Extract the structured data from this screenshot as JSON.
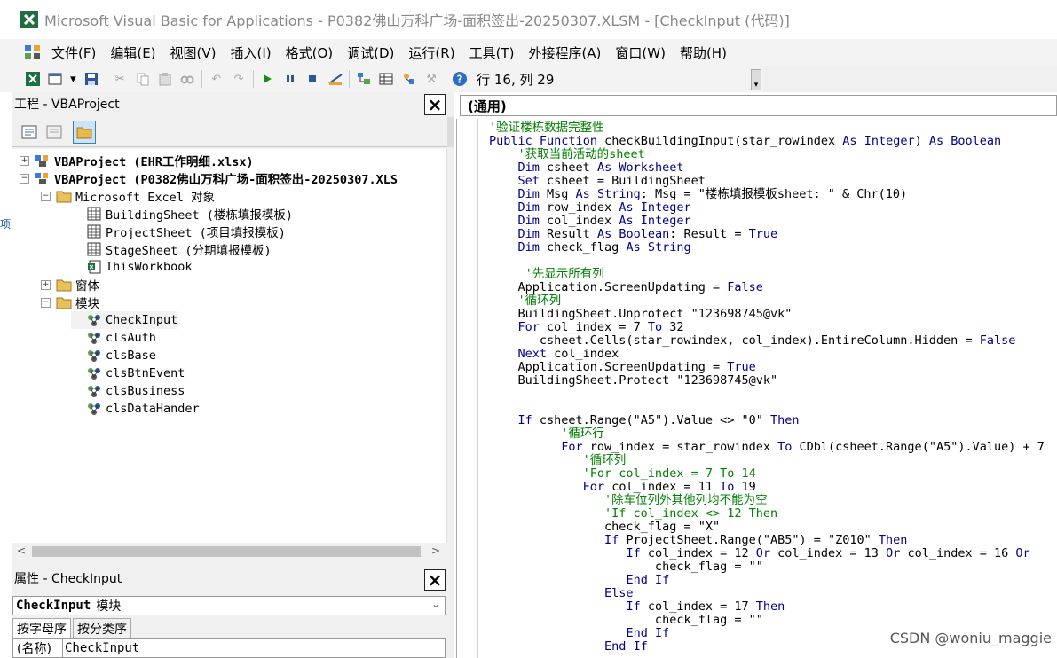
{
  "window": {
    "title": "Microsoft Visual Basic for Applications - P0382佛山万科广场-面积签出-20250307.XLSM - [CheckInput (代码)]"
  },
  "menu": [
    "文件(F)",
    "编辑(E)",
    "视图(V)",
    "插入(I)",
    "格式(O)",
    "调试(D)",
    "运行(R)",
    "工具(T)",
    "外接程序(A)",
    "窗口(W)",
    "帮助(H)"
  ],
  "toolbar": {
    "cursor_position": "行 16, 列 29"
  },
  "project_pane": {
    "title": "工程 - VBAProject",
    "tree": [
      {
        "label": "VBAProject (EHR工作明细.xlsx)",
        "level": 0,
        "expander": "+",
        "icon": "vba-project-icon",
        "bold": true
      },
      {
        "label": "VBAProject (P0382佛山万科广场-面积签出-20250307.XLS",
        "level": 0,
        "expander": "-",
        "icon": "vba-project-icon",
        "bold": true
      },
      {
        "label": "Microsoft Excel 对象",
        "level": 1,
        "expander": "-",
        "icon": "folder-icon",
        "bold": false
      },
      {
        "label": "BuildingSheet (楼栋填报模板)",
        "level": 2,
        "expander": "",
        "icon": "sheet-icon",
        "bold": false
      },
      {
        "label": "ProjectSheet (项目填报模板)",
        "level": 2,
        "expander": "",
        "icon": "sheet-icon",
        "bold": false
      },
      {
        "label": "StageSheet (分期填报模板)",
        "level": 2,
        "expander": "",
        "icon": "sheet-icon",
        "bold": false
      },
      {
        "label": "ThisWorkbook",
        "level": 2,
        "expander": "",
        "icon": "workbook-icon",
        "bold": false
      },
      {
        "label": "窗体",
        "level": 1,
        "expander": "+",
        "icon": "folder-icon",
        "bold": false
      },
      {
        "label": "模块",
        "level": 1,
        "expander": "-",
        "icon": "folder-icon",
        "bold": false
      },
      {
        "label": "CheckInput",
        "level": 2,
        "expander": "",
        "icon": "module-icon",
        "bold": false,
        "selected": true
      },
      {
        "label": "clsAuth",
        "level": 2,
        "expander": "",
        "icon": "module-icon",
        "bold": false
      },
      {
        "label": "clsBase",
        "level": 2,
        "expander": "",
        "icon": "module-icon",
        "bold": false
      },
      {
        "label": "clsBtnEvent",
        "level": 2,
        "expander": "",
        "icon": "module-icon",
        "bold": false
      },
      {
        "label": "clsBusiness",
        "level": 2,
        "expander": "",
        "icon": "module-icon",
        "bold": false
      },
      {
        "label": "clsDataHander",
        "level": 2,
        "expander": "",
        "icon": "module-icon",
        "bold": false
      }
    ]
  },
  "properties_pane": {
    "title": "属性 - CheckInput",
    "object_name": "CheckInput",
    "object_type": "模块",
    "tabs": [
      "按字母序",
      "按分类序"
    ],
    "rows": [
      {
        "key": "(名称)",
        "value": "CheckInput"
      }
    ]
  },
  "code_window": {
    "scope_combo": "(通用)",
    "lines": [
      {
        "text": "'验证楼栋数据完整性",
        "type": "comment"
      },
      {
        "text": "Public Function checkBuildingInput(star_rowindex As Integer) As Boolean",
        "type": "code"
      },
      {
        "text": "    '获取当前活动的sheet",
        "type": "comment"
      },
      {
        "text": "    Dim csheet As Worksheet",
        "type": "code"
      },
      {
        "text": "    Set csheet = BuildingSheet",
        "type": "code"
      },
      {
        "text": "    Dim Msg As String: Msg = \"楼栋填报模板sheet: \" & Chr(10)",
        "type": "code"
      },
      {
        "text": "    Dim row_index As Integer",
        "type": "code"
      },
      {
        "text": "    Dim col_index As Integer",
        "type": "code"
      },
      {
        "text": "    Dim Result As Boolean: Result = True",
        "type": "code"
      },
      {
        "text": "    Dim check_flag As String",
        "type": "code"
      },
      {
        "text": "",
        "type": "code"
      },
      {
        "text": "     '先显示所有列",
        "type": "comment"
      },
      {
        "text": "    Application.ScreenUpdating = False",
        "type": "code"
      },
      {
        "text": "    '循环列",
        "type": "comment"
      },
      {
        "text": "    BuildingSheet.Unprotect \"123698745@vk\"",
        "type": "code"
      },
      {
        "text": "    For col_index = 7 To 32",
        "type": "code"
      },
      {
        "text": "       csheet.Cells(star_rowindex, col_index).EntireColumn.Hidden = False",
        "type": "code"
      },
      {
        "text": "    Next col_index",
        "type": "code"
      },
      {
        "text": "    Application.ScreenUpdating = True",
        "type": "code"
      },
      {
        "text": "    BuildingSheet.Protect \"123698745@vk\"",
        "type": "code"
      },
      {
        "text": "",
        "type": "code"
      },
      {
        "text": "",
        "type": "code"
      },
      {
        "text": "    If csheet.Range(\"A5\").Value <> \"0\" Then",
        "type": "code"
      },
      {
        "text": "          '循环行",
        "type": "comment"
      },
      {
        "text": "          For row_index = star_rowindex To CDbl(csheet.Range(\"A5\").Value) + 7",
        "type": "code"
      },
      {
        "text": "             '循环列",
        "type": "comment"
      },
      {
        "text": "             'For col_index = 7 To 14",
        "type": "comment"
      },
      {
        "text": "             For col_index = 11 To 19",
        "type": "code"
      },
      {
        "text": "                '除车位列外其他列均不能为空",
        "type": "comment"
      },
      {
        "text": "                'If col_index <> 12 Then",
        "type": "comment"
      },
      {
        "text": "                check_flag = \"X\"",
        "type": "code"
      },
      {
        "text": "                If ProjectSheet.Range(\"AB5\") = \"Z010\" Then",
        "type": "code"
      },
      {
        "text": "                   If col_index = 12 Or col_index = 13 Or col_index = 16 Or",
        "type": "code"
      },
      {
        "text": "                       check_flag = \"\"",
        "type": "code"
      },
      {
        "text": "                   End If",
        "type": "code"
      },
      {
        "text": "                Else",
        "type": "code"
      },
      {
        "text": "                   If col_index = 17 Then",
        "type": "code"
      },
      {
        "text": "                       check_flag = \"\"",
        "type": "code"
      },
      {
        "text": "                   End If",
        "type": "code"
      },
      {
        "text": "                End If",
        "type": "code"
      }
    ]
  },
  "watermark": "CSDN @woniu_maggie",
  "colors": {
    "keyword": "#00008b",
    "comment": "#008000",
    "selection_border": "#3c7fb1"
  }
}
